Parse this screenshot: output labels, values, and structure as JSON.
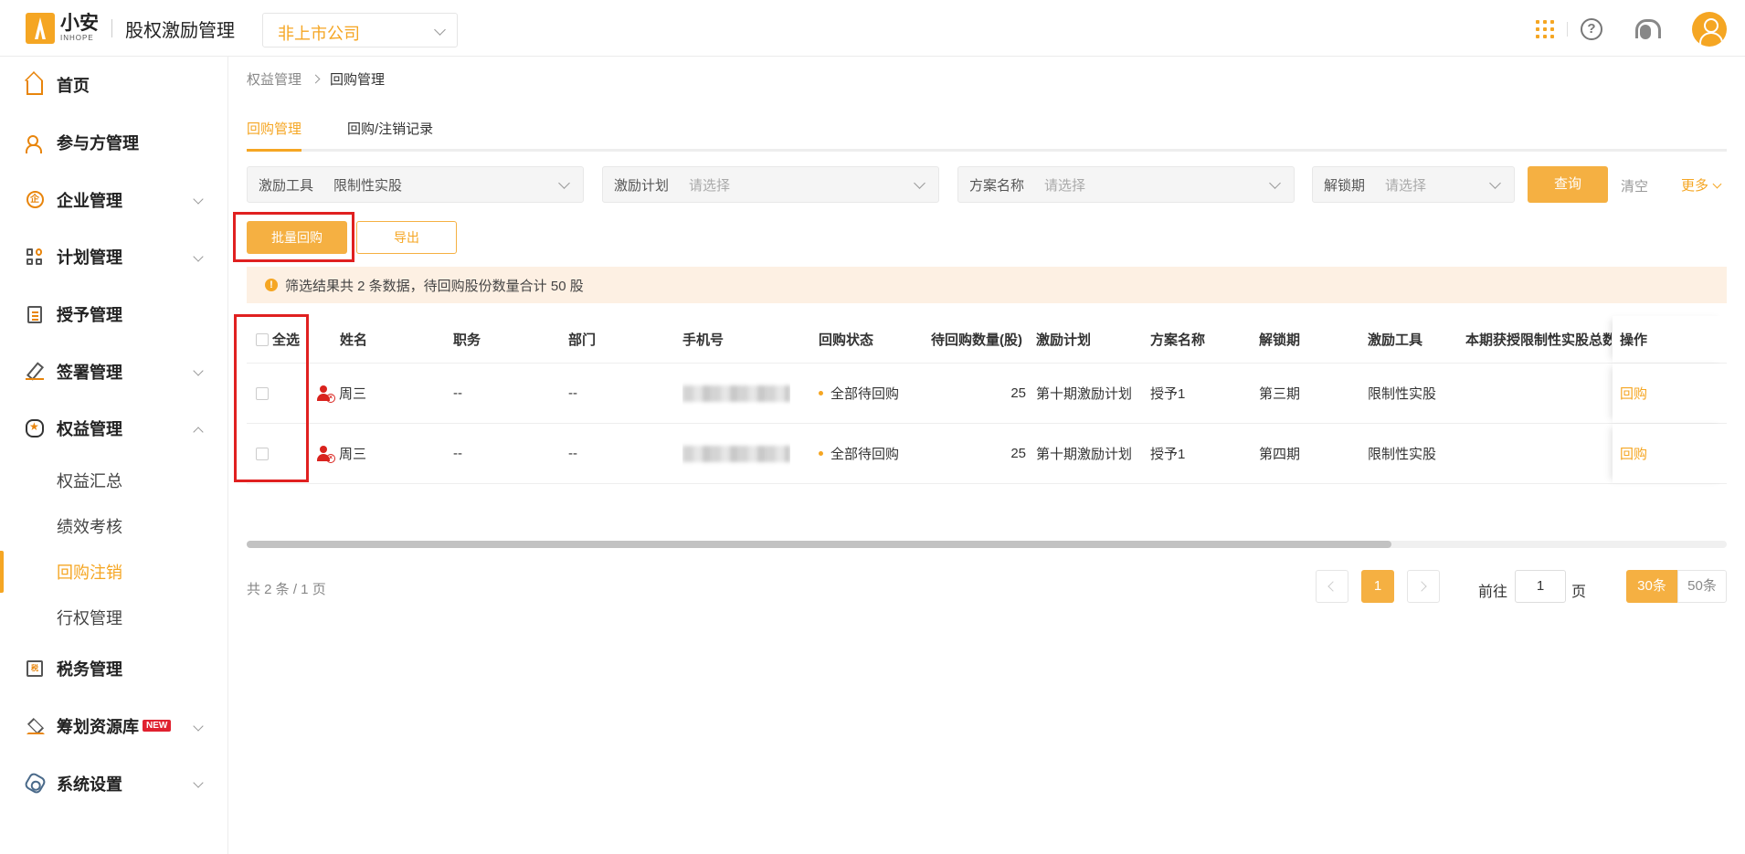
{
  "header": {
    "logo_name": "小安",
    "logo_sub": "INHOPE",
    "app_title": "股权激励管理",
    "company_select": "非上市公司"
  },
  "sidebar": {
    "items": [
      {
        "label": "首页",
        "icon": "home-icon"
      },
      {
        "label": "参与方管理",
        "icon": "people-icon"
      },
      {
        "label": "企业管理",
        "icon": "enterprise-icon"
      },
      {
        "label": "计划管理",
        "icon": "plan-icon"
      },
      {
        "label": "授予管理",
        "icon": "grant-icon"
      },
      {
        "label": "签署管理",
        "icon": "sign-icon"
      },
      {
        "label": "权益管理",
        "icon": "equity-icon"
      }
    ],
    "equity_sub": [
      "权益汇总",
      "绩效考核",
      "回购注销",
      "行权管理"
    ],
    "bottom_items": [
      {
        "label": "税务管理",
        "icon": "tax-icon"
      },
      {
        "label": "筹划资源库",
        "icon": "resource-icon",
        "badge": "NEW"
      },
      {
        "label": "系统设置",
        "icon": "settings-icon"
      }
    ]
  },
  "breadcrumb": {
    "parent": "权益管理",
    "current": "回购管理"
  },
  "tabs": [
    "回购管理",
    "回购/注销记录"
  ],
  "filters": {
    "tool": {
      "label": "激励工具",
      "value": "限制性实股"
    },
    "plan": {
      "label": "激励计划",
      "placeholder": "请选择"
    },
    "scheme": {
      "label": "方案名称",
      "placeholder": "请选择"
    },
    "unlock": {
      "label": "解锁期",
      "placeholder": "请选择"
    },
    "query": "查询",
    "clear": "清空",
    "more": "更多"
  },
  "actions": {
    "batch": "批量回购",
    "export": "导出"
  },
  "notice": "筛选结果共 2 条数据，待回购股份数量合计 50 股",
  "table": {
    "select_all": "全选",
    "columns": [
      "姓名",
      "职务",
      "部门",
      "手机号",
      "回购状态",
      "待回购数量(股)",
      "激励计划",
      "方案名称",
      "解锁期",
      "激励工具",
      "本期获授限制性实股总数",
      "操作"
    ],
    "rows": [
      {
        "name": "周三",
        "title": "--",
        "dept": "--",
        "status": "全部待回购",
        "qty": "25",
        "plan": "第十期激励计划",
        "scheme": "授予1",
        "unlock": "第三期",
        "tool": "限制性实股",
        "action": "回购"
      },
      {
        "name": "周三",
        "title": "--",
        "dept": "--",
        "status": "全部待回购",
        "qty": "25",
        "plan": "第十期激励计划",
        "scheme": "授予1",
        "unlock": "第四期",
        "tool": "限制性实股",
        "action": "回购"
      }
    ]
  },
  "pager": {
    "total": "共 2 条 / 1 页",
    "current": "1",
    "goto_label": "前往",
    "goto_value": "1",
    "goto_unit": "页",
    "size30": "30条",
    "size50": "50条"
  },
  "colors": {
    "accent": "#f5a623",
    "highlight": "#e02020"
  }
}
